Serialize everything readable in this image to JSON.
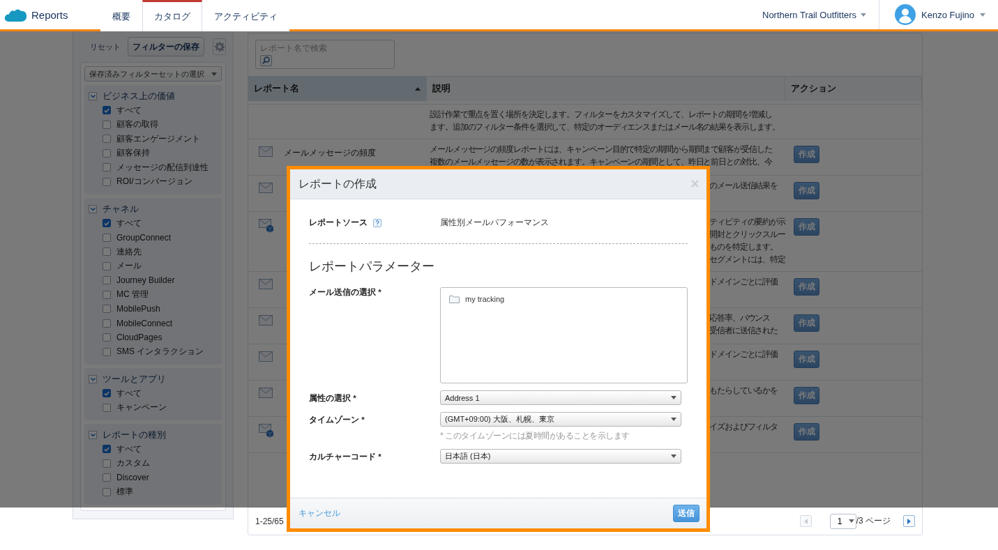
{
  "header": {
    "app_name": "Reports",
    "tabs": [
      {
        "label": "概要",
        "selected": false
      },
      {
        "label": "カタログ",
        "selected": true
      },
      {
        "label": "アクティビティ",
        "selected": false
      }
    ],
    "org": "Northern Trail Outfitters",
    "user": "Kenzo Fujino"
  },
  "sidebar": {
    "reset": "リセット",
    "save_button": "フィルターの保存",
    "saved_filter_select": "保存済みフィルターセットの選択",
    "groups": [
      {
        "title": "ビジネス上の価値",
        "expanded": true,
        "options": [
          {
            "label": "すべて",
            "checked": true
          },
          {
            "label": "顧客の取得",
            "checked": false
          },
          {
            "label": "顧客エンゲージメント",
            "checked": false
          },
          {
            "label": "顧客保持",
            "checked": false
          },
          {
            "label": "メッセージの配信到達性",
            "checked": false
          },
          {
            "label": "ROI/コンバージョン",
            "checked": false
          }
        ]
      },
      {
        "title": "チャネル",
        "expanded": true,
        "options": [
          {
            "label": "すべて",
            "checked": true
          },
          {
            "label": "GroupConnect",
            "checked": false
          },
          {
            "label": "連絡先",
            "checked": false
          },
          {
            "label": "メール",
            "checked": false
          },
          {
            "label": "Journey Builder",
            "checked": false
          },
          {
            "label": "MC 管理",
            "checked": false
          },
          {
            "label": "MobilePush",
            "checked": false
          },
          {
            "label": "MobileConnect",
            "checked": false
          },
          {
            "label": "CloudPages",
            "checked": false
          },
          {
            "label": "SMS インタラクション",
            "checked": false
          }
        ]
      },
      {
        "title": "ツールとアプリ",
        "expanded": true,
        "options": [
          {
            "label": "すべて",
            "checked": true
          },
          {
            "label": "キャンペーン",
            "checked": false
          }
        ]
      },
      {
        "title": "レポートの種別",
        "expanded": true,
        "options": [
          {
            "label": "すべて",
            "checked": true
          },
          {
            "label": "カスタム",
            "checked": false
          },
          {
            "label": "Discover",
            "checked": false
          },
          {
            "label": "標準",
            "checked": false
          }
        ]
      }
    ]
  },
  "search": {
    "placeholder": "レポート名で検索"
  },
  "table": {
    "columns": [
      {
        "label": "レポート名",
        "sorted": true
      },
      {
        "label": "説明",
        "sorted": false
      },
      {
        "label": "アクション",
        "sorted": false
      }
    ],
    "rows": [
      {
        "kind": "top",
        "description": [
          "設計作業で重点を置く場所を決定します。フィルターをカスタマイズして、レポートの期間を増減し",
          "ます。追加のフィルター条件を選択して、特定のオーディエンスまたはメール名の結果を表示します。"
        ]
      },
      {
        "kind": "mail",
        "name": "メールメッセージの頻度",
        "description": [
          "メールメッセージの頻度レポートには、キャンペーン目的で特定の期間から期間まで顧客が受信した",
          "複数のメールメッセージの数が表示されます。キャンペーンの期間として、昨日と前日との対比、今"
        ],
        "button": "作成"
      },
      {
        "kind": "mail",
        "description": [
          "のメール送信結果を"
        ],
        "button": "作成"
      },
      {
        "kind": "mail-box",
        "description": [
          "ティビティの要約が示",
          "開封とクリックスルー",
          "ものを特定します。",
          "セグメントには、特定"
        ],
        "button": "作成"
      },
      {
        "kind": "mail",
        "description": [
          "ドメインごとに評価"
        ],
        "button": "作成"
      },
      {
        "kind": "mail",
        "description": [
          "応答率、バウンス",
          "受信者に送信された"
        ],
        "button": "作成"
      },
      {
        "kind": "mail",
        "description": [
          "ドメインごとに評価"
        ],
        "button": "作成"
      },
      {
        "kind": "mail",
        "description": [
          "もたらしているかを"
        ],
        "button": "作成"
      },
      {
        "kind": "mail-box",
        "description": [
          "イズおよびフィルタ"
        ],
        "button": "作成"
      }
    ]
  },
  "pagination": {
    "range": "1-25/65",
    "prev_disabled": true,
    "page": "1",
    "total": "/3 ページ"
  },
  "modal": {
    "title": "レポートの作成",
    "source_label": "レポートソース",
    "source_value": "属性別メールパフォーマンス",
    "section_title": "レポートパラメーター",
    "fields": [
      {
        "kind": "tree",
        "label": "メール送信の選択 *",
        "items": [
          "my tracking"
        ]
      },
      {
        "kind": "select",
        "label": "属性の選択 *",
        "value": "Address 1"
      },
      {
        "kind": "select",
        "label": "タイムゾーン *",
        "value": "(GMT+09:00) 大阪、札幌、東京",
        "note": "* このタイムゾーンには夏時間があることを示します"
      },
      {
        "kind": "select",
        "label": "カルチャーコード *",
        "value": "日本語 (日本)"
      }
    ],
    "cancel": "キャンセル",
    "submit": "送信"
  }
}
